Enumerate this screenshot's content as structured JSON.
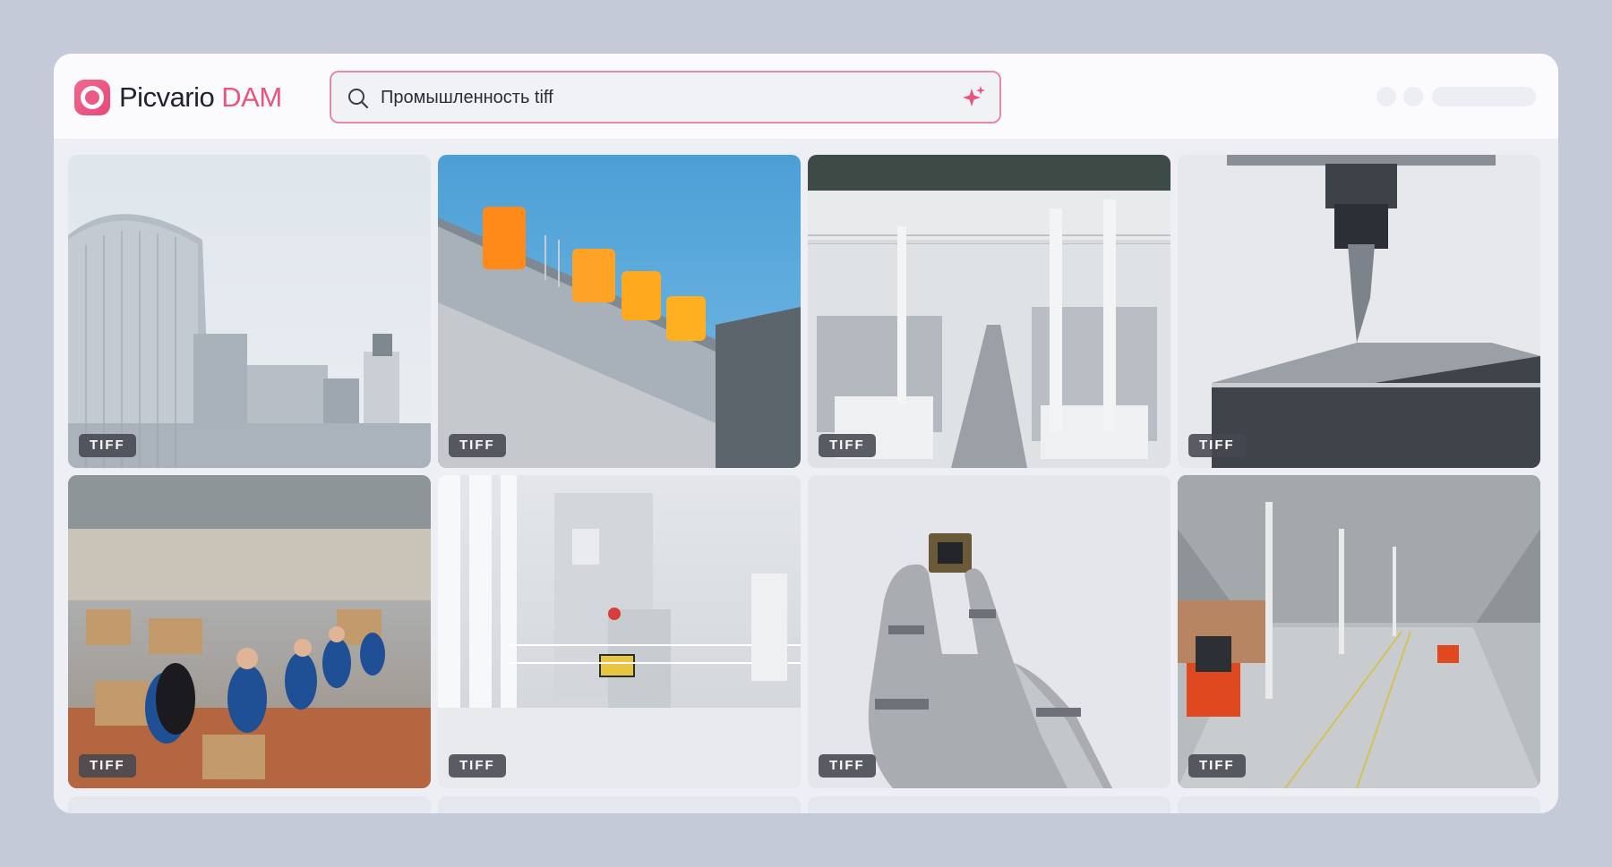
{
  "app": {
    "logo_name": "Picvario",
    "logo_accent": "DAM"
  },
  "search": {
    "value": "Промышленность tiff"
  },
  "results": [
    {
      "format": "TIFF",
      "subject": "factory-building"
    },
    {
      "format": "TIFF",
      "subject": "orange-tanks-on-roof"
    },
    {
      "format": "TIFF",
      "subject": "production-hall"
    },
    {
      "format": "TIFF",
      "subject": "cnc-drill"
    },
    {
      "format": "TIFF",
      "subject": "assembly-line-workers"
    },
    {
      "format": "TIFF",
      "subject": "white-industrial-machine"
    },
    {
      "format": "TIFF",
      "subject": "robot-hand-chip"
    },
    {
      "format": "TIFF",
      "subject": "warehouse-forklifts"
    }
  ],
  "colors": {
    "background": "#c5cad9",
    "accent": "#e8557f",
    "search_border": "#e38aa8",
    "badge": "#464850"
  }
}
